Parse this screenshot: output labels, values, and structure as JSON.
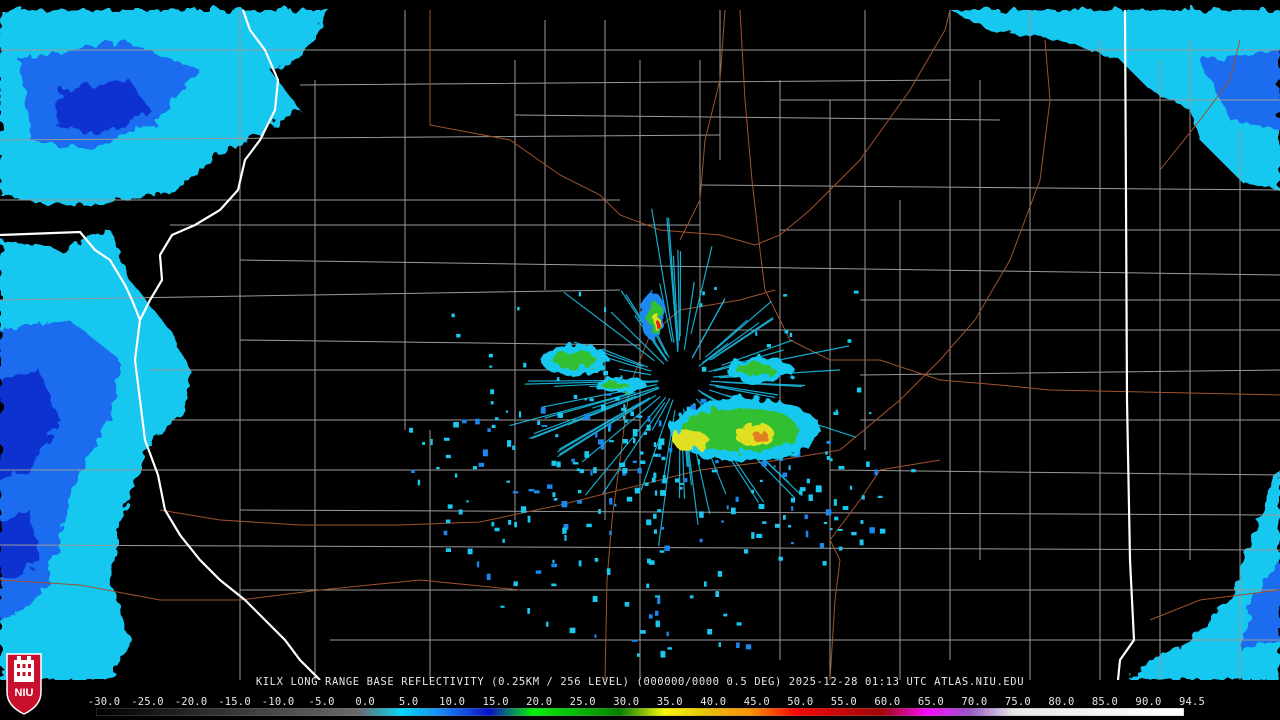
{
  "caption": "KILX LONG RANGE BASE REFLECTIVITY (0.25KM / 256 LEVEL) (000000/0000 0.5 DEG) 2025-12-28 01:13 UTC  ATLAS.NIU.EDU",
  "logo_text": "NIU",
  "scale_ticks": [
    "-30.0",
    "-25.0",
    "-20.0",
    "-15.0",
    "-10.0",
    "-5.0",
    "0.0",
    "5.0",
    "10.0",
    "15.0",
    "20.0",
    "25.0",
    "30.0",
    "35.0",
    "40.0",
    "45.0",
    "50.0",
    "55.0",
    "60.0",
    "65.0",
    "70.0",
    "75.0",
    "80.0",
    "85.0",
    "90.0",
    "94.5"
  ],
  "colors": {
    "background": "#000000",
    "county_lines": "#9a9a9a",
    "state_lines": "#ffffff",
    "roads": "#a0522d",
    "echo_light": "#1ad0f0",
    "echo_mid": "#1060f0",
    "echo_green": "#30c030",
    "echo_yellow": "#e0e020",
    "echo_red": "#e02020"
  },
  "colorbar_stops": [
    {
      "dbz": -30,
      "color": "#000000"
    },
    {
      "dbz": 0,
      "color": "#6a6a6a"
    },
    {
      "dbz": 5,
      "color": "#08d8f8"
    },
    {
      "dbz": 10,
      "color": "#1a7cf0"
    },
    {
      "dbz": 15,
      "color": "#0a10c8"
    },
    {
      "dbz": 20,
      "color": "#08f008"
    },
    {
      "dbz": 25,
      "color": "#08b808"
    },
    {
      "dbz": 30,
      "color": "#068006"
    },
    {
      "dbz": 35,
      "color": "#f8f808"
    },
    {
      "dbz": 40,
      "color": "#e8c008"
    },
    {
      "dbz": 45,
      "color": "#f89008"
    },
    {
      "dbz": 50,
      "color": "#f80808"
    },
    {
      "dbz": 55,
      "color": "#c80808"
    },
    {
      "dbz": 60,
      "color": "#a00808"
    },
    {
      "dbz": 65,
      "color": "#f808f8"
    },
    {
      "dbz": 70,
      "color": "#9858c8"
    },
    {
      "dbz": 75,
      "color": "#e8e8e8"
    },
    {
      "dbz": 94.5,
      "color": "#ffffff"
    }
  ]
}
